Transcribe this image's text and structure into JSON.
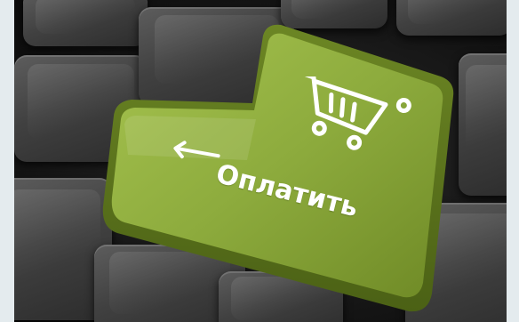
{
  "enter_key": {
    "label": "Оплатить",
    "color": "#8dab3d"
  }
}
